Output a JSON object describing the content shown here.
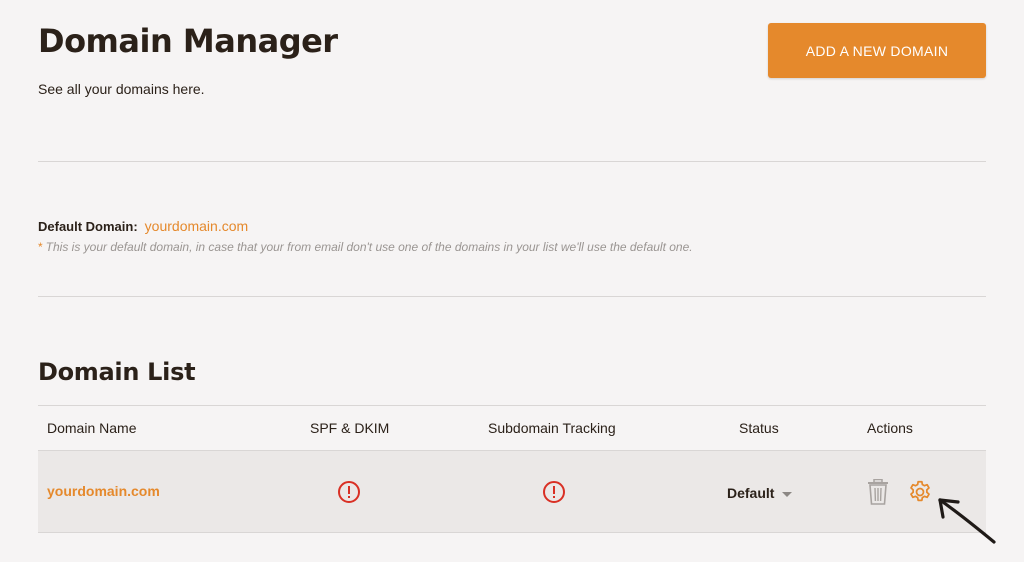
{
  "header": {
    "title": "Domain Manager",
    "subtitle": "See all your domains here.",
    "add_button_label": "ADD A NEW DOMAIN"
  },
  "default_domain": {
    "label": "Default Domain:",
    "value": "yourdomain.com",
    "note_asterisk": "*",
    "note": "This is your default domain, in case that your from email don't use one of the domains in your list we'll use the default one."
  },
  "domain_list": {
    "title": "Domain List",
    "columns": [
      "Domain Name",
      "SPF & DKIM",
      "Subdomain Tracking",
      "Status",
      "Actions"
    ],
    "rows": [
      {
        "domain": "yourdomain.com",
        "spf_dkim": "warning-icon",
        "subdomain_tracking": "warning-icon",
        "status": "Default",
        "actions": [
          "trash-icon",
          "gear-icon"
        ]
      }
    ]
  },
  "colors": {
    "accent": "#e5892c",
    "warning": "#d93025",
    "background": "#f6f4f4",
    "row_background": "#ebe8e7"
  }
}
